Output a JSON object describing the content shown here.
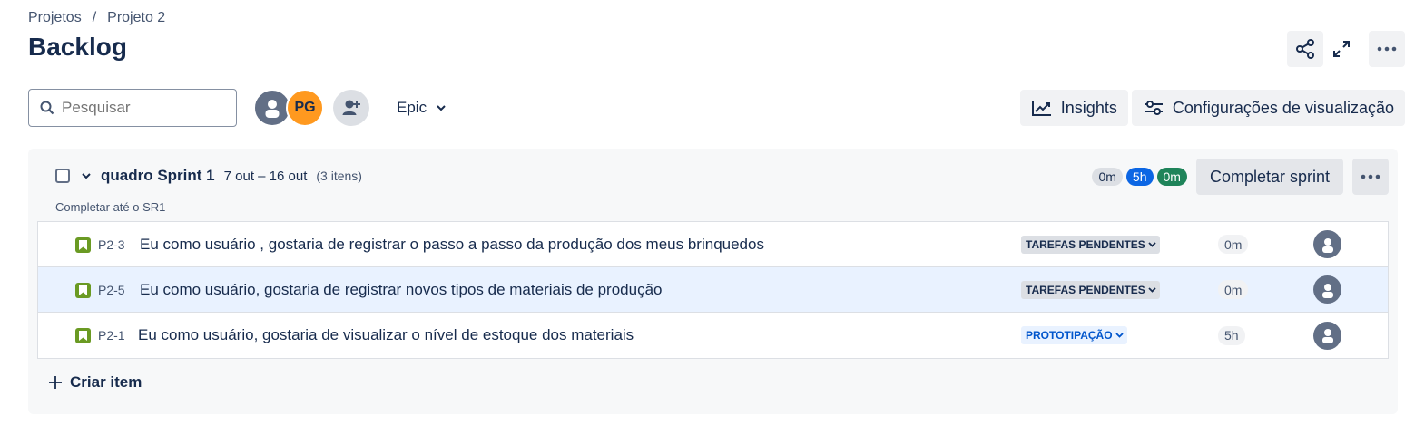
{
  "breadcrumb": {
    "items": [
      "Projetos",
      "Projeto 2"
    ],
    "separator": "/"
  },
  "page": {
    "title": "Backlog"
  },
  "toolbar": {
    "search_placeholder": "Pesquisar",
    "avatar_initials": "PG",
    "epic_label": "Epic",
    "insights_label": "Insights",
    "view_settings_label": "Configurações de visualização"
  },
  "sprint": {
    "name": "quadro Sprint 1",
    "dates": "7 out – 16 out",
    "count": "(3 itens)",
    "goal": "Completar até o SR1",
    "estimates": {
      "todo": "0m",
      "in_progress": "5h",
      "done": "0m"
    },
    "complete_label": "Completar sprint",
    "create_label": "Criar item"
  },
  "issues": [
    {
      "key": "P2-3",
      "summary": "Eu como usuário , gostaria de registrar o passo a passo da produção dos meus brinquedos",
      "status": "TAREFAS PENDENTES",
      "estimate": "0m"
    },
    {
      "key": "P2-5",
      "summary": "Eu como usuário, gostaria de registrar novos tipos de materiais de produção",
      "status": "TAREFAS PENDENTES",
      "estimate": "0m"
    },
    {
      "key": "P2-1",
      "summary": "Eu como usuário, gostaria de visualizar o nível de estoque dos materiais",
      "status": "PROTOTIPAÇÃO",
      "estimate": "5h"
    }
  ],
  "colors": {
    "primary_text": "#172b4d",
    "story": "#6a9a23",
    "blue_pill": "#0c66e4",
    "green_pill": "#1f845a",
    "pg_avatar": "#ff991f",
    "selected_row": "#e9f2ff"
  },
  "icons": [
    "share-icon",
    "fullscreen-icon",
    "more-icon",
    "search-icon",
    "add-person-icon",
    "chevron-down-icon",
    "insights-icon",
    "settings-sliders-icon",
    "story-icon",
    "avatar-icon",
    "plus-icon"
  ]
}
